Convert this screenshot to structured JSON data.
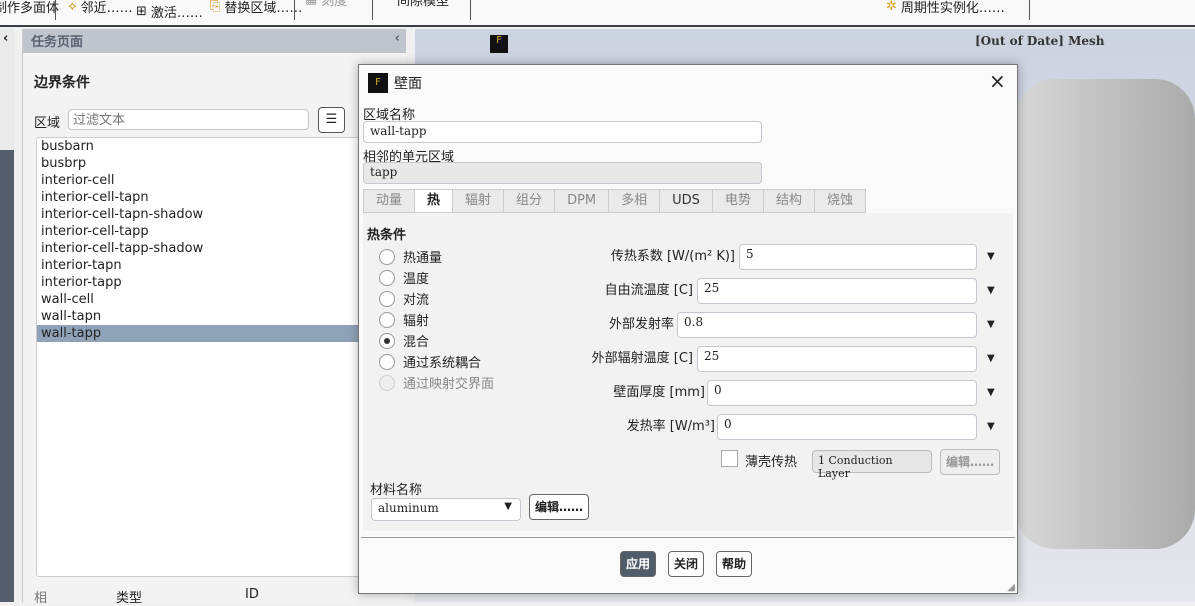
{
  "toolbar": {
    "items": [
      "制作多面体",
      "邻近……",
      "激活……",
      "替换区域……",
      "刻度",
      "间隙模型",
      "周期性实例化……"
    ]
  },
  "task_page": {
    "title": "任务页面",
    "section": "边界条件",
    "zone_label": "区域",
    "filter_placeholder": "过滤文本",
    "zones": [
      "busbarn",
      "busbrp",
      "interior-cell",
      "interior-cell-tapn",
      "interior-cell-tapn-shadow",
      "interior-cell-tapp",
      "interior-cell-tapp-shadow",
      "interior-tapn",
      "interior-tapp",
      "wall-cell",
      "wall-tapn",
      "wall-tapp"
    ],
    "selected": "wall-tapp",
    "columns": [
      "相",
      "类型",
      "ID"
    ]
  },
  "viewport": {
    "title": "[Out of Date] Mesh"
  },
  "dialog": {
    "title": "壁面",
    "zone_name_label": "区域名称",
    "zone_name": "wall-tapp",
    "adjacent_label": "相邻的单元区域",
    "adjacent": "tapp",
    "tabs": [
      "动量",
      "热",
      "辐射",
      "组分",
      "DPM",
      "多相",
      "UDS",
      "电势",
      "结构",
      "烧蚀"
    ],
    "active_tab": "热",
    "thermal_label": "热条件",
    "conditions": [
      "热通量",
      "温度",
      "对流",
      "辐射",
      "混合",
      "通过系统耦合",
      "通过映射交界面"
    ],
    "selected_condition": "混合",
    "params": [
      {
        "label": "传热系数 [W/(m² K)]",
        "value": "5"
      },
      {
        "label": "自由流温度 [C]",
        "value": "25"
      },
      {
        "label": "外部发射率",
        "value": "0.8"
      },
      {
        "label": "外部辐射温度 [C]",
        "value": "25"
      },
      {
        "label": "壁面厚度 [mm]",
        "value": "0"
      },
      {
        "label": "发热率 [W/m³]",
        "value": "0"
      }
    ],
    "shell_label": "薄壳传热",
    "layer_button": "1 Conduction Layer",
    "edit": "编辑……",
    "material_label": "材料名称",
    "material": "aluminum",
    "apply": "应用",
    "close": "关闭",
    "help": "帮助"
  }
}
